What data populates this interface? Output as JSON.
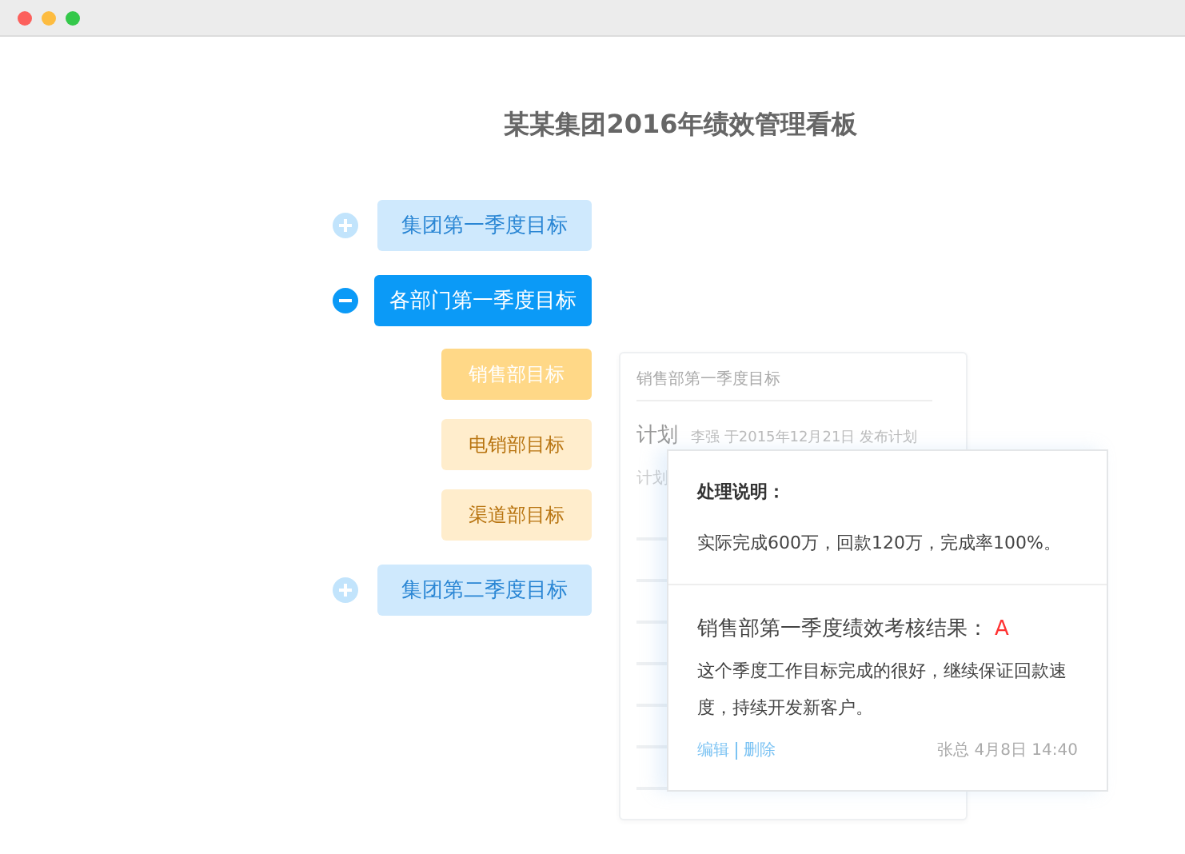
{
  "title": "某某集团2016年绩效管理看板",
  "groups": [
    {
      "label": "集团第一季度目标",
      "expanded": false,
      "selected": false
    },
    {
      "label": "各部门第一季度目标",
      "expanded": true,
      "selected": true,
      "children": [
        {
          "label": "销售部目标",
          "selected": true
        },
        {
          "label": "电销部目标",
          "selected": false
        },
        {
          "label": "渠道部目标",
          "selected": false
        }
      ]
    },
    {
      "label": "集团第二季度目标",
      "expanded": false,
      "selected": false
    }
  ],
  "detail_card": {
    "title": "销售部第一季度目标",
    "plan_label": "计划",
    "plan_meta": "李强  于2015年12月21日  发布计划",
    "row_label": "计划"
  },
  "popup": {
    "heading": "处理说明：",
    "note": "实际完成600万，回款120万，完成率100%。",
    "result_label": "销售部第一季度绩效考核结果：",
    "grade": "A",
    "comment": "这个季度工作目标完成的很好，继续保证回款速度，持续开发新客户。",
    "actions": [
      "编辑",
      "删除"
    ],
    "footer": "张总  4月8日  14:40"
  }
}
